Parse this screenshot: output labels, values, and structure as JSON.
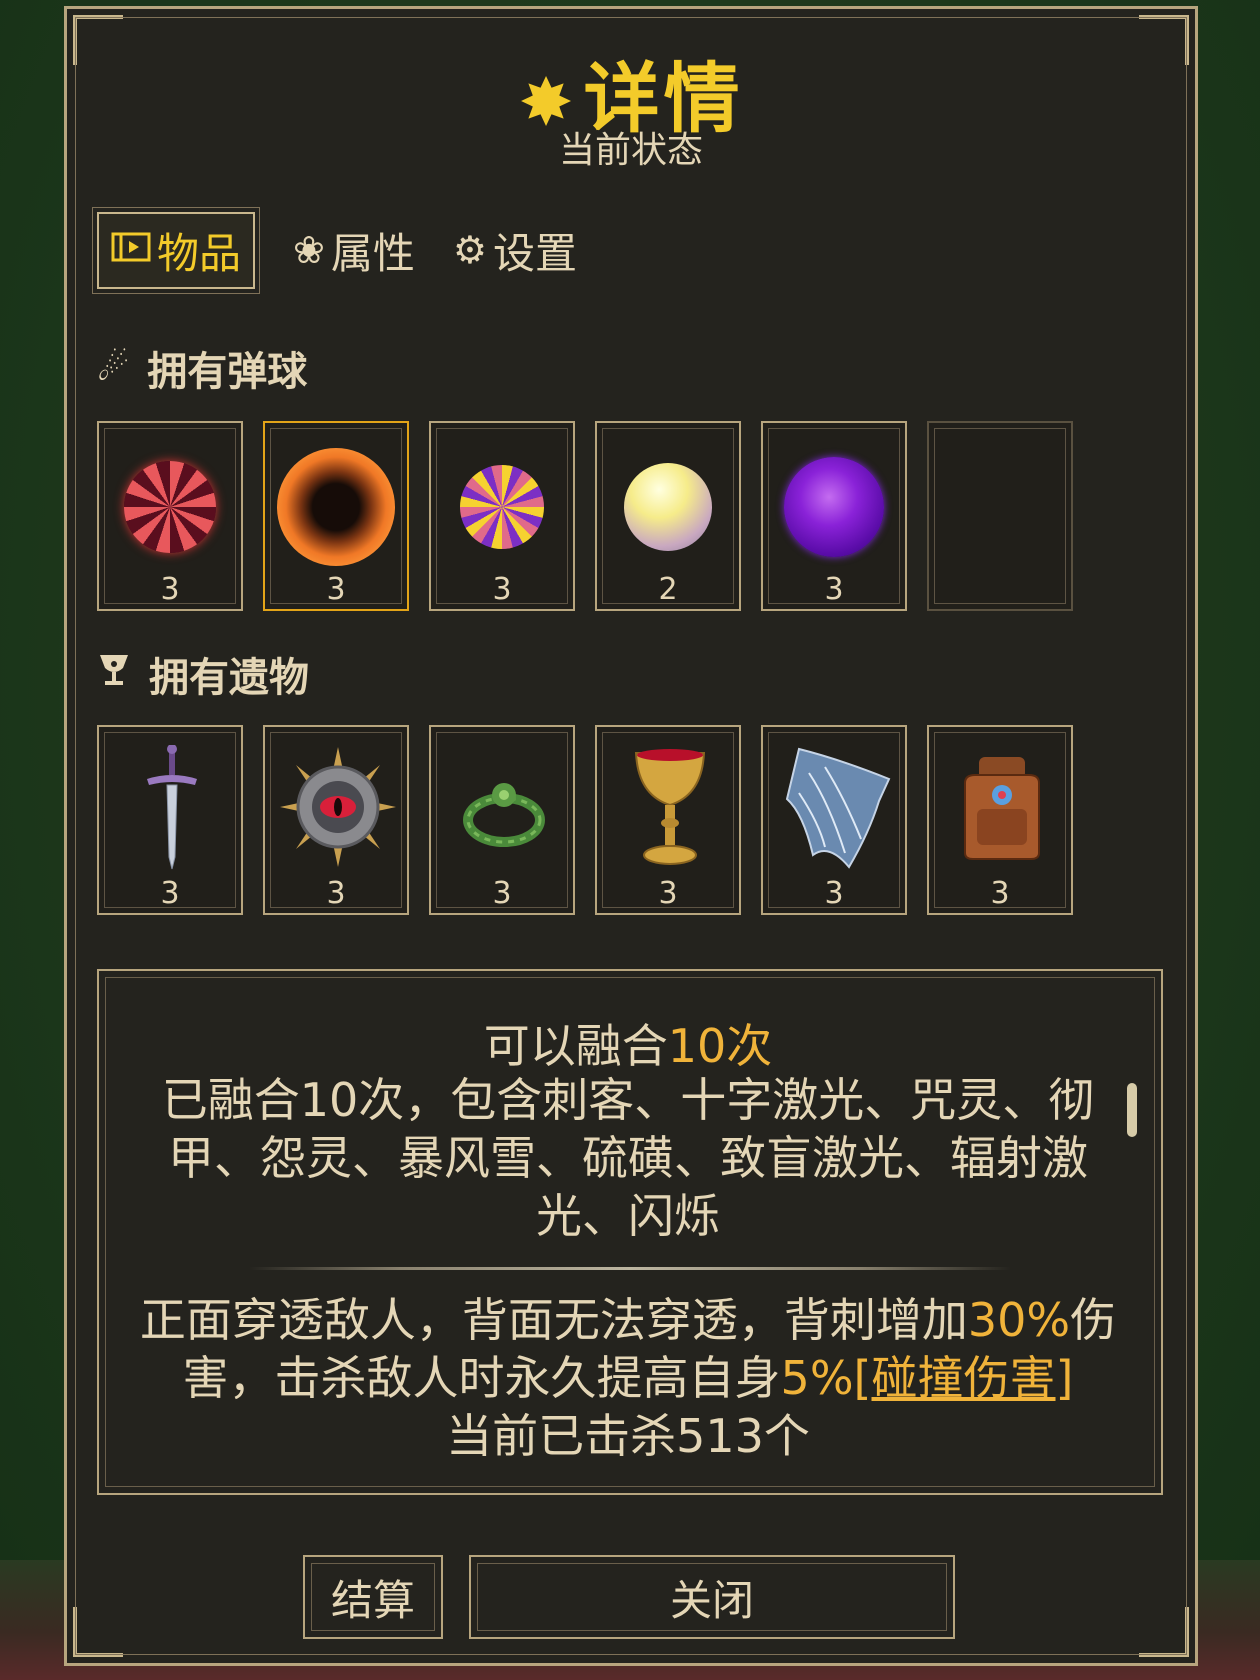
{
  "header": {
    "title": "详情",
    "subtitle": "当前状态"
  },
  "tabs": [
    {
      "label": "物品",
      "icon": "film-strip-icon"
    },
    {
      "label": "属性",
      "icon": "flower-icon"
    },
    {
      "label": "设置",
      "icon": "gear-icon"
    }
  ],
  "balls_section": {
    "title": "拥有弹球",
    "icon": "comet-icon"
  },
  "balls": [
    {
      "count": "3",
      "icon": "red-spiral-orb-icon"
    },
    {
      "count": "3",
      "icon": "orange-ring-orb-icon"
    },
    {
      "count": "3",
      "icon": "yellow-purple-swirl-orb-icon"
    },
    {
      "count": "2",
      "icon": "pale-yellow-orb-icon"
    },
    {
      "count": "3",
      "icon": "purple-orb-icon"
    },
    {
      "count": "",
      "icon": ""
    }
  ],
  "relics_section": {
    "title": "拥有遗物",
    "icon": "chalice-icon"
  },
  "relics": [
    {
      "count": "3",
      "icon": "dagger-icon"
    },
    {
      "count": "3",
      "icon": "spiked-eye-shield-icon"
    },
    {
      "count": "3",
      "icon": "leaf-wreath-icon"
    },
    {
      "count": "3",
      "icon": "golden-goblet-icon"
    },
    {
      "count": "3",
      "icon": "blue-cloak-icon"
    },
    {
      "count": "3",
      "icon": "leather-backpack-icon"
    }
  ],
  "description": {
    "fusion_prefix": "可以融合",
    "fusion_count": "10次",
    "fused_text": "已融合10次，包含刺客、十字激光、咒灵、彻甲、怨灵、暴风雪、硫磺、致盲激光、辐射激光、闪烁",
    "effect_part1": "正面穿透敌人，背面无法穿透，背刺增加",
    "effect_pct1": "30%",
    "effect_part2": "伤害，击杀敌人时永久提高自身",
    "effect_pct2": "5%",
    "effect_link": "[碰撞伤害]",
    "kills_text": "当前已击杀513个"
  },
  "buttons": {
    "settle": "结算",
    "close": "关闭"
  },
  "colors": {
    "accent_gold": "#f3cb2a",
    "frame": "#b7a57e",
    "panel": "#24231e",
    "highlight": "#f0b33a"
  }
}
